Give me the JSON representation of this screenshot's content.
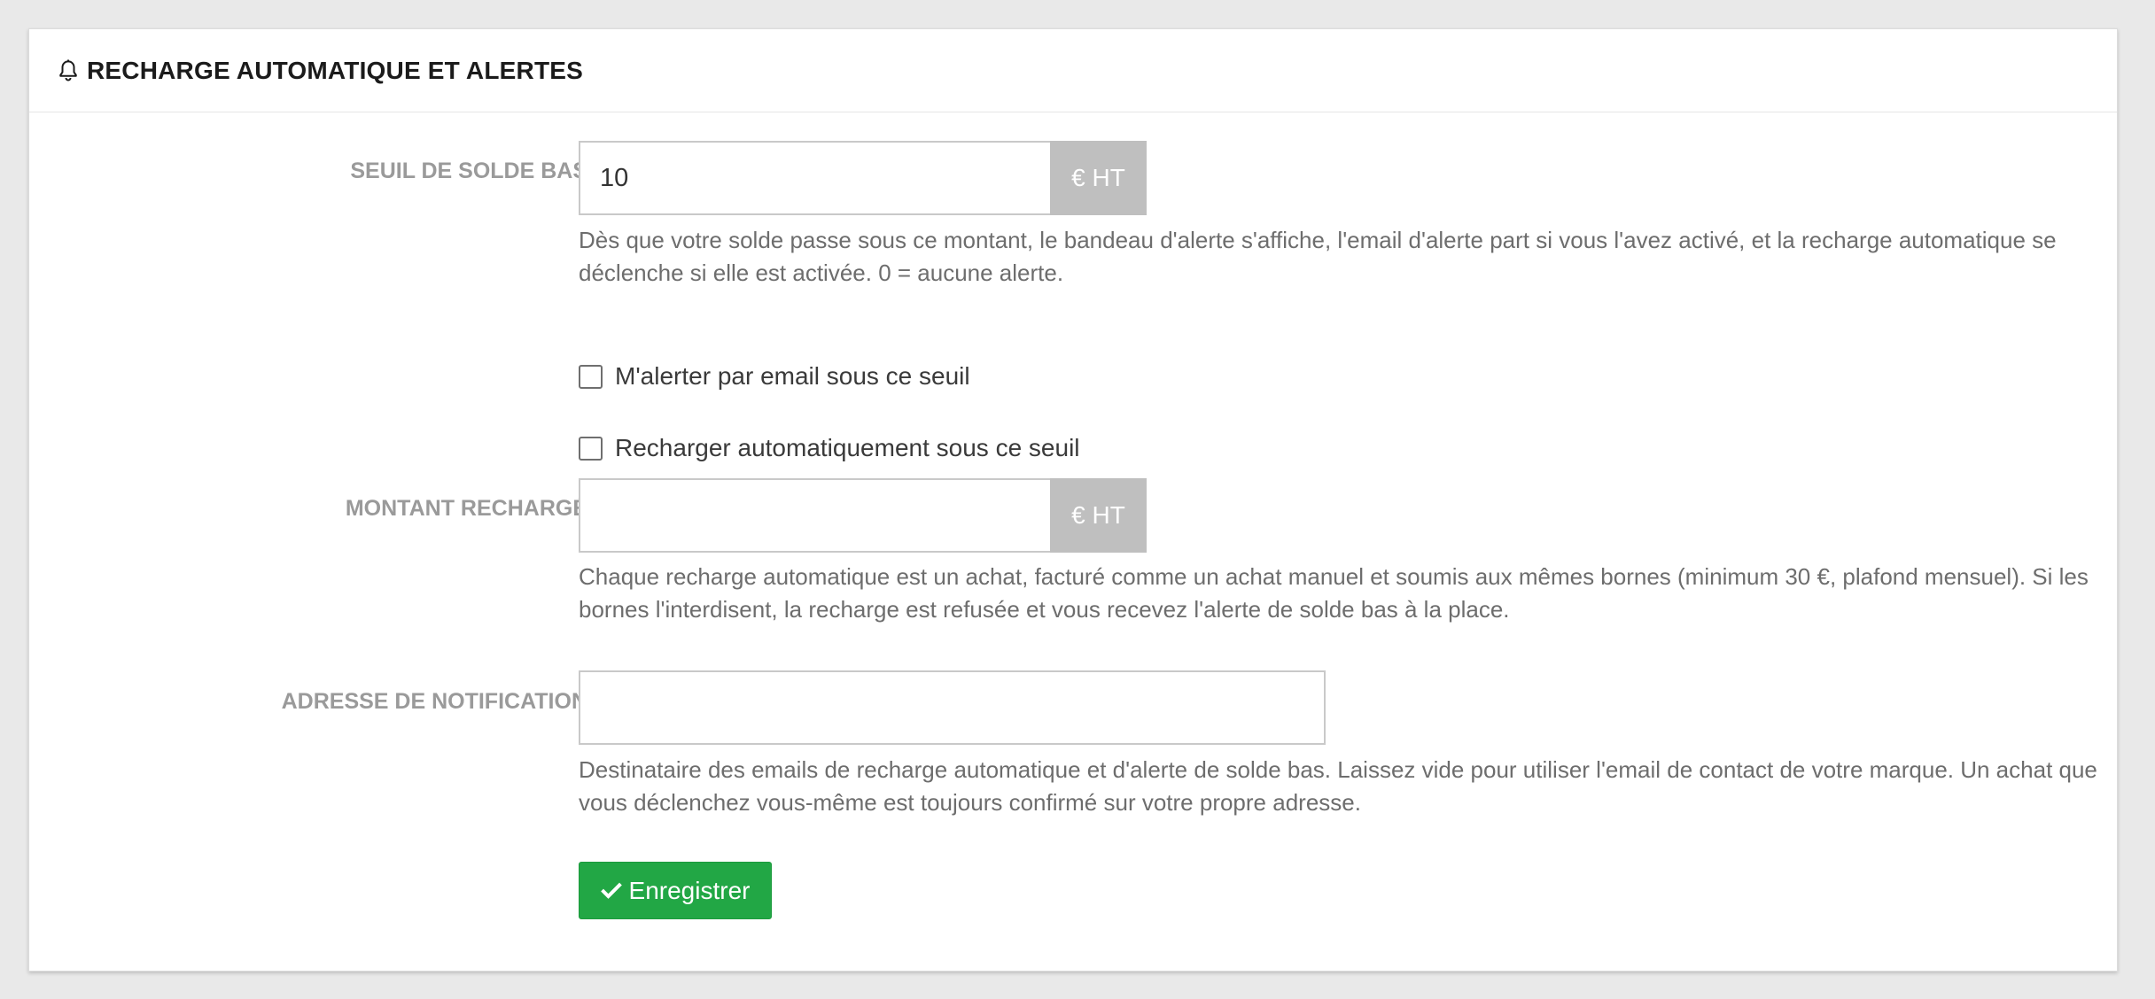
{
  "header": {
    "icon": "bell-icon",
    "title": "RECHARGE AUTOMATIQUE ET ALERTES"
  },
  "threshold": {
    "label": "SEUIL DE SOLDE BAS",
    "value": "10",
    "unit": "€ HT",
    "help": "Dès que votre solde passe sous ce montant, le bandeau d'alerte s'affiche, l'email d'alerte part si vous l'avez activé, et la recharge automatique se déclenche si elle est activée. 0 = aucune alerte."
  },
  "email_alert": {
    "label": "M'alerter par email sous ce seuil",
    "checked": false
  },
  "auto_recharge": {
    "label": "Recharger automatiquement sous ce seuil",
    "checked": false
  },
  "amount": {
    "label": "MONTANT RECHARGÉ",
    "value": "",
    "unit": "€ HT",
    "help": "Chaque recharge automatique est un achat, facturé comme un achat manuel et soumis aux mêmes bornes (minimum 30 €, plafond mensuel). Si les bornes l'interdisent, la recharge est refusée et vous recevez l'alerte de solde bas à la place."
  },
  "notification": {
    "label": "ADRESSE DE NOTIFICATION",
    "value": "",
    "help": "Destinataire des emails de recharge automatique et d'alerte de solde bas. Laissez vide pour utiliser l'email de contact de votre marque. Un achat que vous déclenchez vous-même est toujours confirmé sur votre propre adresse."
  },
  "save": {
    "icon": "check-icon",
    "label": "Enregistrer",
    "color": "#22a745"
  }
}
